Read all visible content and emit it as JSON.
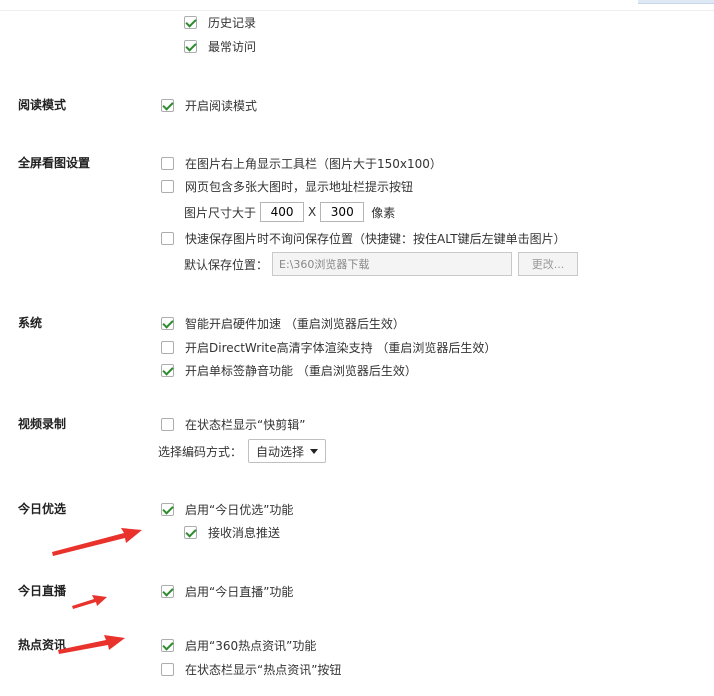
{
  "history": {
    "items": [
      {
        "label": "历史记录",
        "checked": true
      },
      {
        "label": "最常访问",
        "checked": true
      }
    ]
  },
  "reading": {
    "title": "阅读模式",
    "items": [
      {
        "label": "开启阅读模式",
        "checked": true
      }
    ]
  },
  "fullscreen": {
    "title": "全屏看图设置",
    "items": [
      {
        "label": "在图片右上角显示工具栏（图片大于150x100）",
        "checked": false
      },
      {
        "label": "网页包含多张大图时，显示地址栏提示按钮",
        "checked": false
      },
      {
        "label": "快速保存图片时不询问保存位置（快捷键：按住ALT键后左键单击图片）",
        "checked": false
      }
    ],
    "size_label": "图片尺寸大于",
    "width_value": "400",
    "x_sep": "X",
    "height_value": "300",
    "unit": "像素",
    "save_label": "默认保存位置：",
    "save_path": "E:\\360浏览器下载",
    "change_button": "更改..."
  },
  "system": {
    "title": "系统",
    "items": [
      {
        "label": "智能开启硬件加速 （重启浏览器后生效）",
        "checked": true
      },
      {
        "label": "开启DirectWrite高清字体渲染支持 （重启浏览器后生效）",
        "checked": false
      },
      {
        "label": "开启单标签静音功能 （重启浏览器后生效）",
        "checked": true
      }
    ]
  },
  "video": {
    "title": "视频录制",
    "items": [
      {
        "label": "在状态栏显示“快剪辑”",
        "checked": false
      }
    ],
    "encode_label": "选择编码方式：",
    "encode_value": "自动选择"
  },
  "today_pick": {
    "title": "今日优选",
    "items": [
      {
        "label": "启用“今日优选”功能",
        "checked": true
      },
      {
        "label": "接收消息推送",
        "checked": true
      }
    ]
  },
  "today_live": {
    "title": "今日直播",
    "items": [
      {
        "label": "启用“今日直播”功能",
        "checked": true
      }
    ]
  },
  "hot_news": {
    "title": "热点资讯",
    "items": [
      {
        "label": "启用“360热点资讯”功能",
        "checked": true
      },
      {
        "label": "在状态栏显示“热点资讯”按钮",
        "checked": false
      }
    ]
  },
  "colors": {
    "accent_check": "#2e8b2e",
    "annotation_arrow": "#e8322b"
  }
}
